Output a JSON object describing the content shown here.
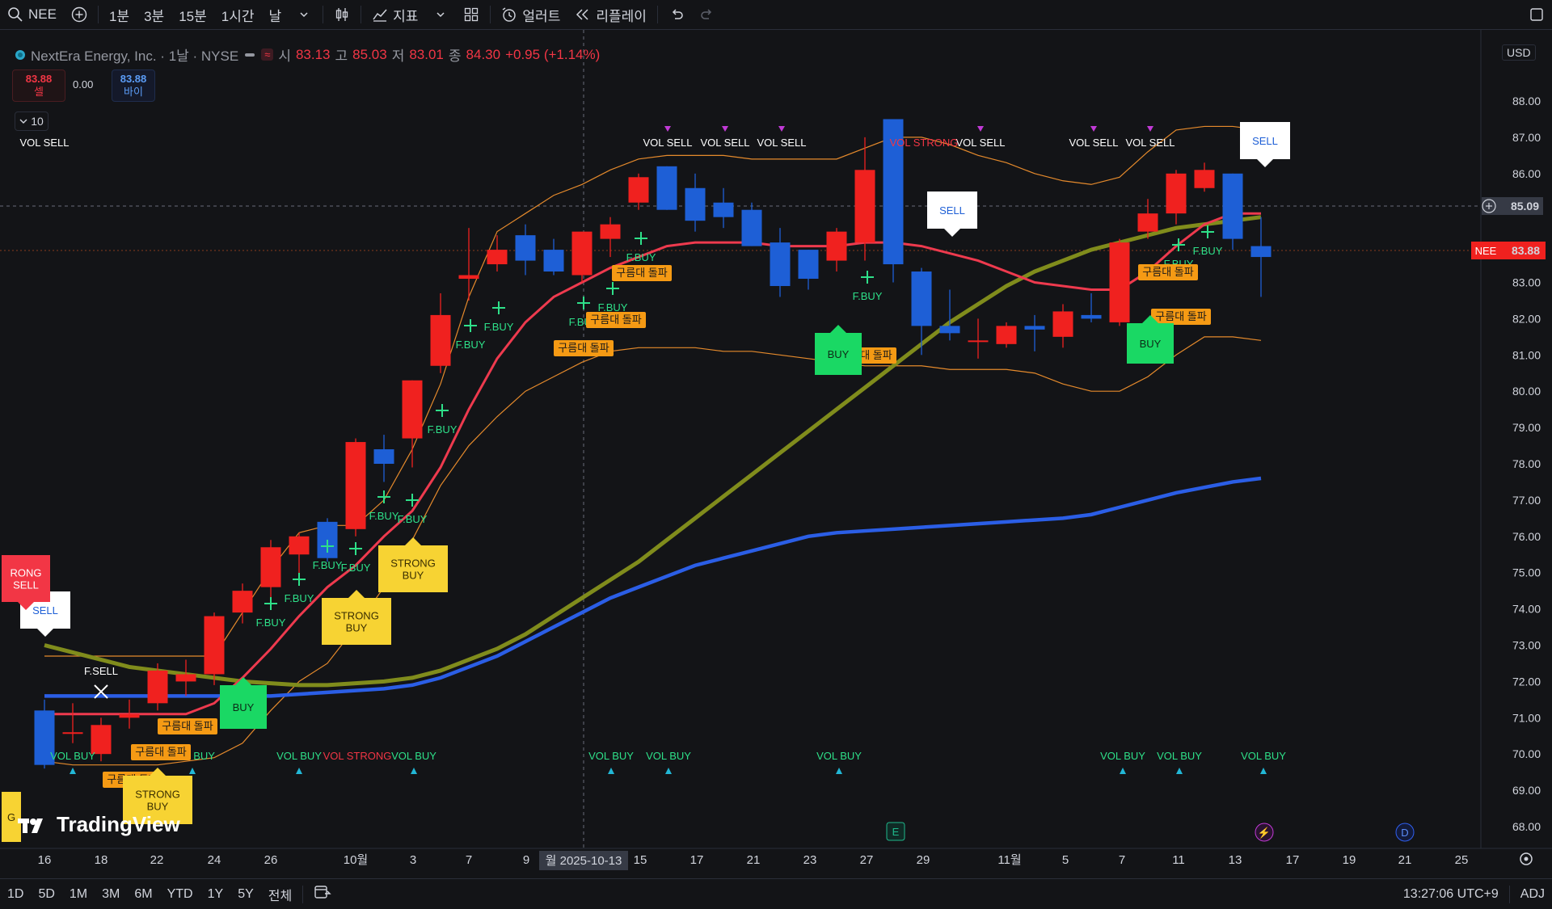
{
  "toolbar": {
    "symbol": "NEE",
    "intervals": [
      "1분",
      "3분",
      "15분",
      "1시간",
      "날"
    ],
    "indicators_label": "지표",
    "alert_label": "얼러트",
    "replay_label": "리플레이"
  },
  "legend": {
    "title": "NextEra Energy, Inc. · 1날 · NYSE",
    "open_k": "시",
    "open_v": "83.13",
    "high_k": "고",
    "high_v": "85.03",
    "low_k": "저",
    "low_v": "83.01",
    "close_k": "종",
    "close_v": "84.30",
    "change": "+0.95 (+1.14%)"
  },
  "trade": {
    "sell_price": "83.88",
    "sell_label": "셀",
    "spread": "0.00",
    "buy_price": "83.88",
    "buy_label": "바이"
  },
  "collapse_count": "10",
  "currency": "USD",
  "price_tag": {
    "symbol": "NEE",
    "price": "83.88"
  },
  "crosshair_price": "85.09",
  "crosshair_date": "월 2025-10-13",
  "bottombar": {
    "ranges": [
      "1D",
      "5D",
      "1M",
      "3M",
      "6M",
      "YTD",
      "1Y",
      "5Y",
      "전체"
    ],
    "clock": "13:27:06 UTC+9",
    "adj": "ADJ"
  },
  "logo_text": "TradingView",
  "colors": {
    "up": "#f0211f",
    "down": "#1e5fd6",
    "bg": "#131417",
    "accent": "#2962ff"
  },
  "chart_data": {
    "type": "candlestick",
    "y_ticks": [
      "88.00",
      "87.00",
      "86.00",
      "85.00",
      "84.00",
      "83.00",
      "82.00",
      "81.00",
      "80.00",
      "79.00",
      "78.00",
      "77.00",
      "76.00",
      "75.00",
      "74.00",
      "73.00",
      "72.00",
      "71.00",
      "70.00",
      "69.00",
      "68.00"
    ],
    "x_ticks": [
      "16",
      "18",
      "22",
      "24",
      "26",
      "10월",
      "3",
      "7",
      "9",
      "15",
      "17",
      "21",
      "23",
      "27",
      "29",
      "11월",
      "5",
      "7",
      "11",
      "13",
      "17",
      "19",
      "21",
      "25"
    ],
    "candles": [
      {
        "o": 71.2,
        "h": 71.5,
        "l": 69.6,
        "c": 69.7
      },
      {
        "o": 70.6,
        "h": 71.4,
        "l": 70.3,
        "c": 70.6
      },
      {
        "o": 70.0,
        "h": 71.0,
        "l": 69.8,
        "c": 70.8
      },
      {
        "o": 71.0,
        "h": 71.5,
        "l": 70.7,
        "c": 71.1
      },
      {
        "o": 71.4,
        "h": 72.5,
        "l": 71.2,
        "c": 72.3
      },
      {
        "o": 72.0,
        "h": 72.6,
        "l": 71.6,
        "c": 72.2
      },
      {
        "o": 72.2,
        "h": 73.9,
        "l": 71.9,
        "c": 73.8
      },
      {
        "o": 73.9,
        "h": 74.7,
        "l": 73.6,
        "c": 74.5
      },
      {
        "o": 74.6,
        "h": 75.9,
        "l": 74.1,
        "c": 75.7
      },
      {
        "o": 75.5,
        "h": 76.1,
        "l": 74.8,
        "c": 76.0
      },
      {
        "o": 76.4,
        "h": 76.5,
        "l": 75.3,
        "c": 75.4
      },
      {
        "o": 76.2,
        "h": 78.7,
        "l": 76.0,
        "c": 78.6
      },
      {
        "o": 78.4,
        "h": 78.8,
        "l": 77.5,
        "c": 78.0
      },
      {
        "o": 78.7,
        "h": 80.3,
        "l": 77.9,
        "c": 80.3
      },
      {
        "o": 80.7,
        "h": 82.7,
        "l": 80.5,
        "c": 82.1
      },
      {
        "o": 83.1,
        "h": 84.5,
        "l": 82.5,
        "c": 83.2
      },
      {
        "o": 83.5,
        "h": 84.3,
        "l": 83.3,
        "c": 83.9
      },
      {
        "o": 84.3,
        "h": 84.6,
        "l": 83.2,
        "c": 83.6
      },
      {
        "o": 83.9,
        "h": 84.2,
        "l": 83.2,
        "c": 83.3
      },
      {
        "o": 83.2,
        "h": 84.2,
        "l": 83.0,
        "c": 84.4
      },
      {
        "o": 84.2,
        "h": 84.8,
        "l": 83.7,
        "c": 84.6
      },
      {
        "o": 85.2,
        "h": 86.0,
        "l": 85.0,
        "c": 85.9
      },
      {
        "o": 86.2,
        "h": 86.2,
        "l": 85.0,
        "c": 85.0
      },
      {
        "o": 85.6,
        "h": 86.0,
        "l": 84.4,
        "c": 84.7
      },
      {
        "o": 85.2,
        "h": 85.6,
        "l": 84.5,
        "c": 84.8
      },
      {
        "o": 85.0,
        "h": 85.2,
        "l": 84.0,
        "c": 84.0
      },
      {
        "o": 84.1,
        "h": 84.5,
        "l": 82.6,
        "c": 82.9
      },
      {
        "o": 83.9,
        "h": 83.9,
        "l": 82.8,
        "c": 83.1
      },
      {
        "o": 83.6,
        "h": 84.5,
        "l": 83.3,
        "c": 84.4
      },
      {
        "o": 84.1,
        "h": 87.0,
        "l": 83.6,
        "c": 86.1
      },
      {
        "o": 87.5,
        "h": 87.5,
        "l": 83.0,
        "c": 83.5
      },
      {
        "o": 83.3,
        "h": 83.4,
        "l": 81.0,
        "c": 81.8
      },
      {
        "o": 81.8,
        "h": 82.8,
        "l": 81.4,
        "c": 81.6
      },
      {
        "o": 81.4,
        "h": 82.0,
        "l": 80.9,
        "c": 81.4
      },
      {
        "o": 81.3,
        "h": 81.9,
        "l": 81.2,
        "c": 81.8
      },
      {
        "o": 81.8,
        "h": 82.1,
        "l": 81.1,
        "c": 81.7
      },
      {
        "o": 81.5,
        "h": 82.4,
        "l": 81.2,
        "c": 82.2
      },
      {
        "o": 82.1,
        "h": 82.7,
        "l": 81.9,
        "c": 82.0
      },
      {
        "o": 81.9,
        "h": 84.2,
        "l": 81.8,
        "c": 84.1
      },
      {
        "o": 84.4,
        "h": 85.3,
        "l": 84.2,
        "c": 84.9
      },
      {
        "o": 84.9,
        "h": 86.1,
        "l": 84.6,
        "c": 86.0
      },
      {
        "o": 85.6,
        "h": 86.3,
        "l": 85.5,
        "c": 86.1
      },
      {
        "o": 86.0,
        "h": 86.0,
        "l": 83.9,
        "c": 84.2
      },
      {
        "o": 84.0,
        "h": 84.8,
        "l": 82.6,
        "c": 83.7
      }
    ],
    "overlay_lines": {
      "red_ma": [
        71.1,
        71.1,
        71.1,
        71.1,
        71.1,
        71.1,
        71.4,
        72.1,
        72.9,
        73.8,
        74.6,
        75.2,
        76.0,
        76.7,
        77.9,
        79.5,
        80.9,
        81.9,
        82.6,
        83.0,
        83.4,
        83.7,
        84.0,
        84.1,
        84.1,
        84.1,
        84.0,
        84.0,
        84.0,
        84.1,
        84.1,
        84.0,
        83.8,
        83.6,
        83.3,
        83.0,
        82.9,
        82.8,
        82.8,
        83.3,
        84.0,
        84.6,
        84.9,
        84.9
      ],
      "olive_ma": [
        73.0,
        72.8,
        72.6,
        72.4,
        72.3,
        72.2,
        72.1,
        72.0,
        71.95,
        71.9,
        71.9,
        71.95,
        72.0,
        72.1,
        72.3,
        72.6,
        72.9,
        73.3,
        73.8,
        74.3,
        74.8,
        75.3,
        75.9,
        76.5,
        77.1,
        77.7,
        78.3,
        78.9,
        79.5,
        80.1,
        80.7,
        81.3,
        81.9,
        82.4,
        82.9,
        83.3,
        83.6,
        83.9,
        84.1,
        84.3,
        84.5,
        84.6,
        84.7,
        84.8
      ],
      "blue_ma": [
        71.6,
        71.6,
        71.6,
        71.6,
        71.6,
        71.6,
        71.6,
        71.6,
        71.6,
        71.65,
        71.7,
        71.75,
        71.8,
        71.9,
        72.1,
        72.4,
        72.7,
        73.1,
        73.5,
        73.9,
        74.3,
        74.6,
        74.9,
        75.2,
        75.4,
        75.6,
        75.8,
        76.0,
        76.1,
        76.15,
        76.2,
        76.25,
        76.3,
        76.35,
        76.4,
        76.45,
        76.5,
        76.6,
        76.8,
        77.0,
        77.2,
        77.35,
        77.5,
        77.6
      ],
      "bb_upper": [
        72.7,
        72.7,
        72.7,
        72.7,
        72.7,
        72.7,
        72.7,
        73.9,
        75.1,
        76.1,
        76.3,
        76.3,
        77.0,
        78.4,
        80.2,
        82.6,
        84.4,
        84.9,
        85.4,
        85.7,
        86.1,
        86.4,
        86.5,
        86.5,
        86.5,
        86.4,
        86.4,
        86.4,
        86.4,
        86.7,
        87.0,
        87.0,
        86.8,
        86.5,
        86.3,
        86.0,
        85.8,
        85.7,
        85.9,
        86.6,
        87.2,
        87.3,
        87.3,
        87.2
      ],
      "bb_lower": [
        69.8,
        69.7,
        69.7,
        69.7,
        69.7,
        69.8,
        69.9,
        70.3,
        71.2,
        72.0,
        72.5,
        73.5,
        74.6,
        75.9,
        77.4,
        78.5,
        79.3,
        80.0,
        80.4,
        80.8,
        81.1,
        81.2,
        81.2,
        81.2,
        81.1,
        81.1,
        81.0,
        80.9,
        80.8,
        80.7,
        80.7,
        80.7,
        80.6,
        80.6,
        80.6,
        80.5,
        80.2,
        80.0,
        80.0,
        80.4,
        81.0,
        81.5,
        81.5,
        81.4
      ]
    },
    "signals": {
      "vol_sell": "VOL SELL",
      "vol_buy": "VOL BUY",
      "vol_strong": "VOL STRONG",
      "f_buy": "F.BUY",
      "f_sell": "F.SELL",
      "buy": "BUY",
      "sell": "SELL",
      "strong_buy": "STRONG BUY",
      "strong_sell": "STRONG SELL",
      "cloud_break": "구름대 돌파"
    },
    "markers": {
      "earnings": "E",
      "dividend": "D"
    }
  }
}
